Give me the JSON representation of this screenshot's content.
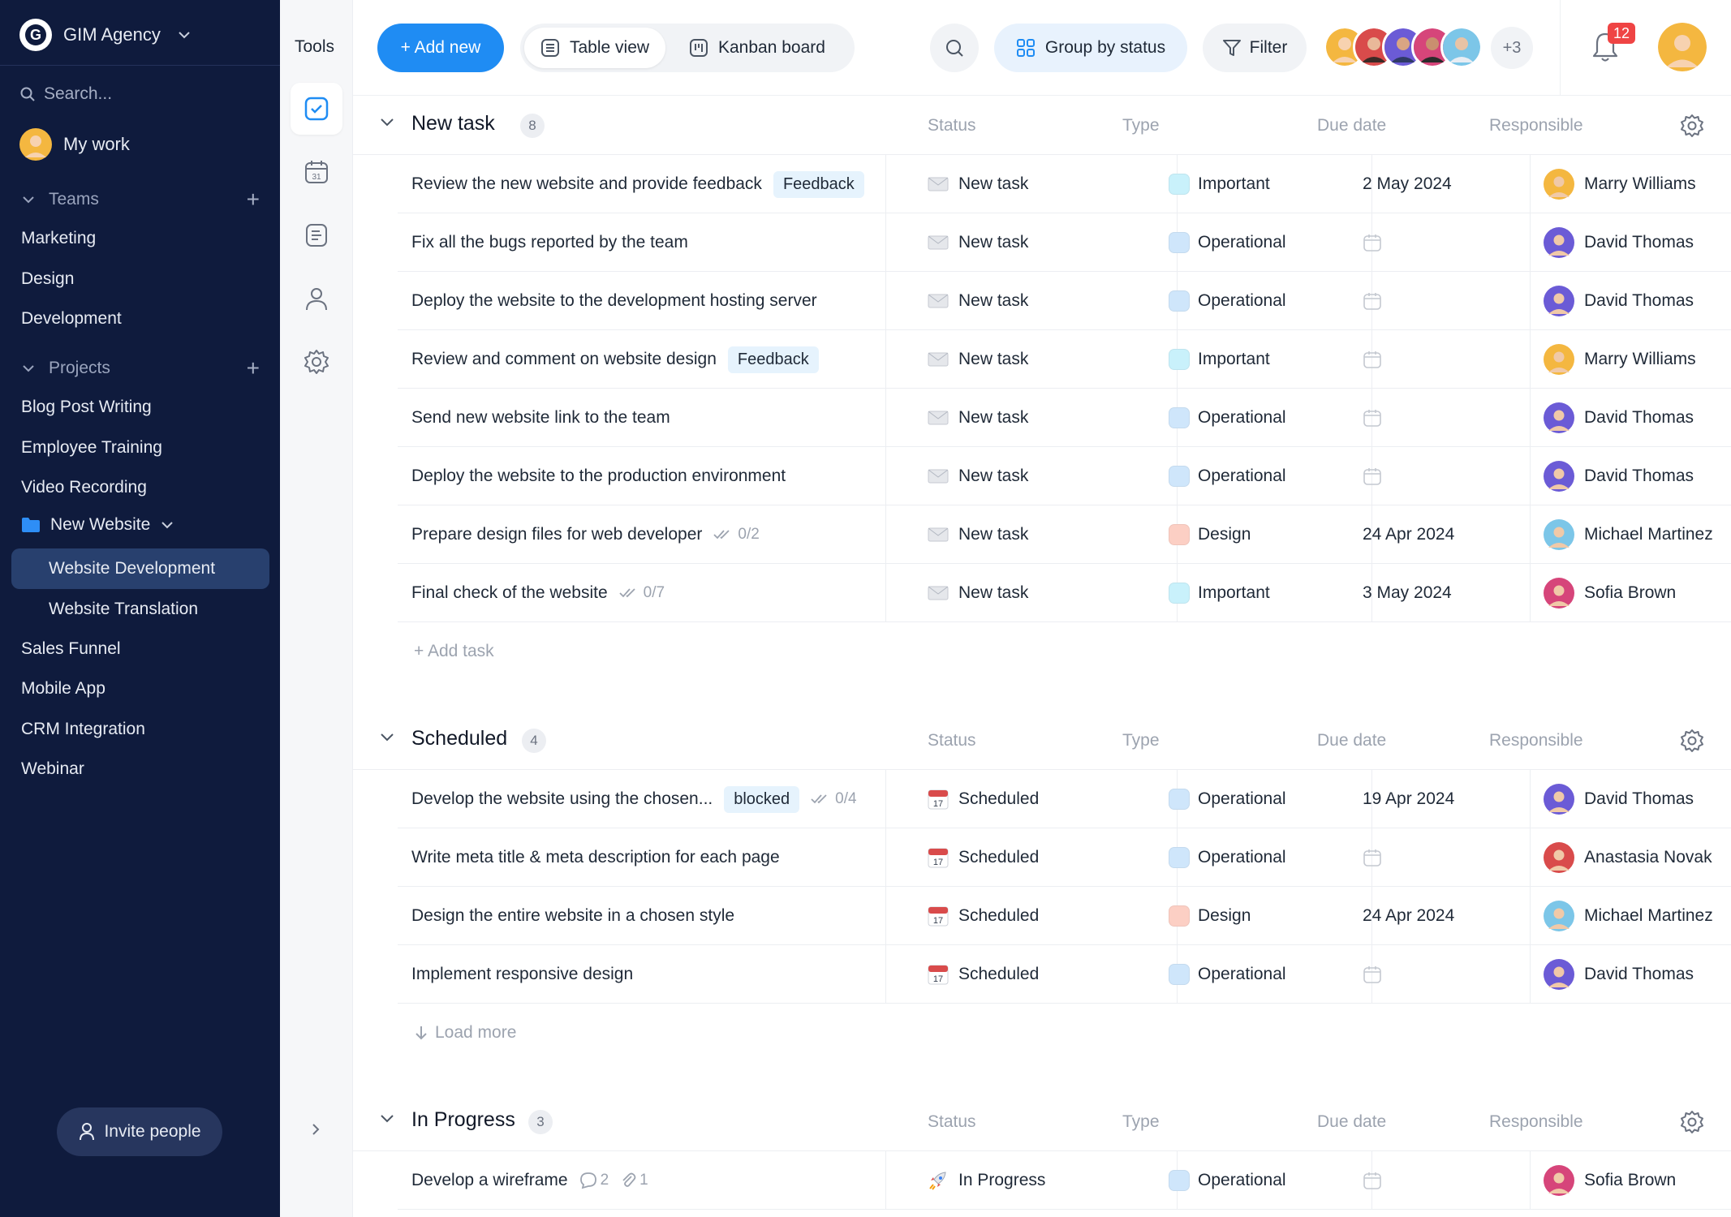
{
  "workspace": {
    "name": "GIM Agency",
    "logo_letter": "G"
  },
  "sidebar": {
    "search_placeholder": "Search...",
    "my_work": "My work",
    "teams_label": "Teams",
    "teams": [
      "Marketing",
      "Design",
      "Development"
    ],
    "projects_label": "Projects",
    "projects_top": [
      "Blog Post Writing",
      "Employee Training",
      "Video Recording"
    ],
    "folder": "New Website",
    "folder_children": [
      "Website Development",
      "Website Translation"
    ],
    "projects_bottom": [
      "Sales Funnel",
      "Mobile App",
      "CRM Integration",
      "Webinar"
    ],
    "active_item": "Website Development",
    "invite": "Invite people"
  },
  "tools": {
    "label": "Tools"
  },
  "toolbar": {
    "add_new": "+ Add new",
    "table_view": "Table view",
    "kanban_board": "Kanban board",
    "group_by": "Group by status",
    "filter": "Filter",
    "more_members": "+3",
    "notifications": "12"
  },
  "columns": {
    "status": "Status",
    "type": "Type",
    "due": "Due date",
    "responsible": "Responsible"
  },
  "type_colors": {
    "Important": "#c9f1fb",
    "Operational": "#cfe6fb",
    "Design": "#fccfc4"
  },
  "people_colors": {
    "Marry Williams": "#f4b740",
    "David Thomas": "#6b5bd6",
    "Michael Martinez": "#7cc6e8",
    "Sofia Brown": "#d6457a",
    "Anastasia Novak": "#d94b4b"
  },
  "groups": [
    {
      "title": "New task",
      "count": "8",
      "footer": "+ Add task",
      "tasks": [
        {
          "title": "Review the new website and provide feedback",
          "tag": "Feedback",
          "subtasks": "",
          "comments": "",
          "attachments": "",
          "status": "New task",
          "type": "Important",
          "due": "2 May 2024",
          "responsible": "Marry Williams"
        },
        {
          "title": "Fix all the bugs reported by the team",
          "tag": "",
          "subtasks": "",
          "comments": "",
          "attachments": "",
          "status": "New task",
          "type": "Operational",
          "due": "",
          "responsible": "David Thomas"
        },
        {
          "title": "Deploy the website to the development hosting server",
          "tag": "",
          "subtasks": "",
          "comments": "",
          "attachments": "",
          "status": "New task",
          "type": "Operational",
          "due": "",
          "responsible": "David Thomas"
        },
        {
          "title": "Review and comment on website design",
          "tag": "Feedback",
          "subtasks": "",
          "comments": "",
          "attachments": "",
          "status": "New task",
          "type": "Important",
          "due": "",
          "responsible": "Marry Williams"
        },
        {
          "title": "Send new website link to the team",
          "tag": "",
          "subtasks": "",
          "comments": "",
          "attachments": "",
          "status": "New task",
          "type": "Operational",
          "due": "",
          "responsible": "David Thomas"
        },
        {
          "title": "Deploy the website to the production environment",
          "tag": "",
          "subtasks": "",
          "comments": "",
          "attachments": "",
          "status": "New task",
          "type": "Operational",
          "due": "",
          "responsible": "David Thomas"
        },
        {
          "title": "Prepare design files for web developer",
          "tag": "",
          "subtasks": "0/2",
          "comments": "",
          "attachments": "",
          "status": "New task",
          "type": "Design",
          "due": "24 Apr 2024",
          "responsible": "Michael Martinez"
        },
        {
          "title": "Final check of the website",
          "tag": "",
          "subtasks": "0/7",
          "comments": "",
          "attachments": "",
          "status": "New task",
          "type": "Important",
          "due": "3 May 2024",
          "responsible": "Sofia Brown"
        }
      ]
    },
    {
      "title": "Scheduled",
      "count": "4",
      "footer": "Load more",
      "tasks": [
        {
          "title": "Develop the website using the chosen...",
          "tag": "blocked",
          "subtasks": "0/4",
          "comments": "",
          "attachments": "",
          "status": "Scheduled",
          "type": "Operational",
          "due": "19 Apr 2024",
          "responsible": "David Thomas"
        },
        {
          "title": "Write meta title & meta description for each page",
          "tag": "",
          "subtasks": "",
          "comments": "",
          "attachments": "",
          "status": "Scheduled",
          "type": "Operational",
          "due": "",
          "responsible": "Anastasia Novak"
        },
        {
          "title": "Design the entire website in a chosen style",
          "tag": "",
          "subtasks": "",
          "comments": "",
          "attachments": "",
          "status": "Scheduled",
          "type": "Design",
          "due": "24 Apr 2024",
          "responsible": "Michael Martinez"
        },
        {
          "title": "Implement responsive design",
          "tag": "",
          "subtasks": "",
          "comments": "",
          "attachments": "",
          "status": "Scheduled",
          "type": "Operational",
          "due": "",
          "responsible": "David Thomas"
        }
      ]
    },
    {
      "title": "In Progress",
      "count": "3",
      "footer": "",
      "tasks": [
        {
          "title": "Develop a wireframe",
          "tag": "",
          "subtasks": "",
          "comments": "2",
          "attachments": "1",
          "status": "In Progress",
          "type": "Operational",
          "due": "",
          "responsible": "Sofia Brown"
        }
      ]
    }
  ]
}
